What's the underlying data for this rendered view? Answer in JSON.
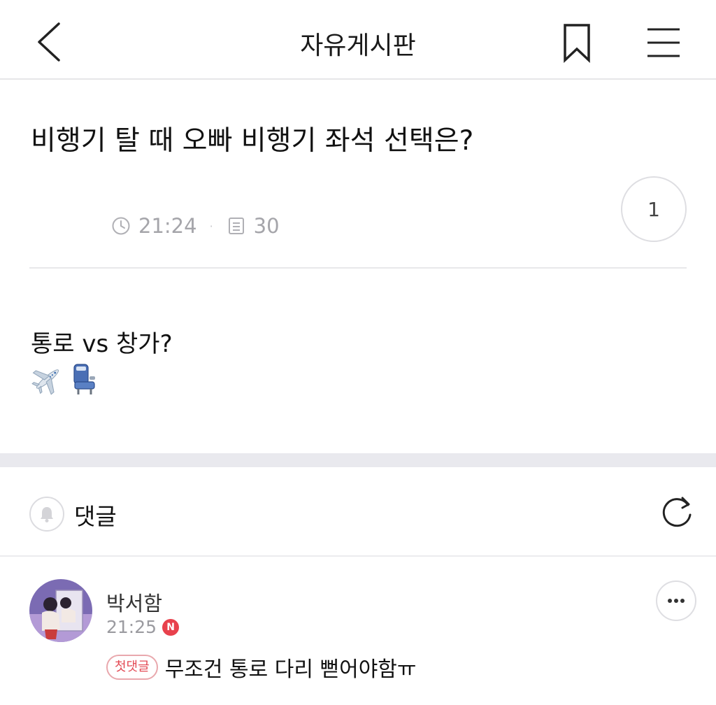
{
  "header": {
    "title": "자유게시판",
    "back_icon": "chevron-left-icon",
    "bookmark_icon": "bookmark-icon",
    "menu_icon": "hamburger-menu-icon"
  },
  "post": {
    "title": "비행기 탈 때 오빠 비행기 좌석 선택은?",
    "time": "21:24",
    "separator": "·",
    "views": "30",
    "like_count": "1",
    "body": "통로 vs 창가?",
    "emojis": [
      "airplane-emoji",
      "seat-emoji"
    ]
  },
  "comments_section": {
    "label": "댓글",
    "bell_icon": "bell-icon",
    "refresh_icon": "refresh-icon"
  },
  "comments": [
    {
      "author": "박서함",
      "time": "21:25",
      "new_badge": "N",
      "first_badge": "첫댓글",
      "text": "무조건 통로 다리 뻗어야함ㅠ"
    }
  ],
  "colors": {
    "accent_red": "#e8414c",
    "meta_gray": "#a5a5aa",
    "band_gray": "#e9e9ee"
  }
}
